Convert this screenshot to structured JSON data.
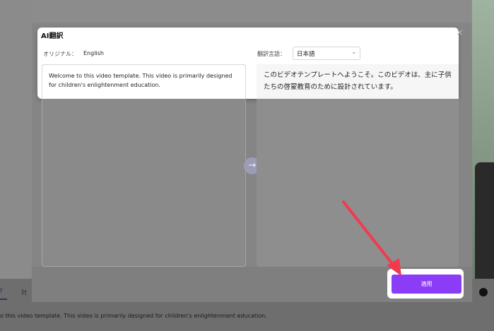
{
  "dialog": {
    "title": "AI翻訳",
    "close_icon": "close-icon"
  },
  "original": {
    "label": "オリジナル：",
    "language": "English",
    "text": "Welcome to this video template. This video is primarily designed for children's enlightenment education."
  },
  "target": {
    "label": "翻訳言語：",
    "language": "日本語",
    "text": "このビデオテンプレートへようこそ。このビデオは、主に子供たちの啓蒙教育のために設計されています。"
  },
  "translate_arrow_icon": "arrow-right-icon",
  "apply_button": {
    "label": "適用"
  },
  "background": {
    "tab_label": "f",
    "tab2_label": "対",
    "caption": "o this video template. This video is primarily designed for children's enlightenment education."
  },
  "colors": {
    "accent": "#8b3cf7",
    "annotation_arrow": "#f23a4f"
  }
}
